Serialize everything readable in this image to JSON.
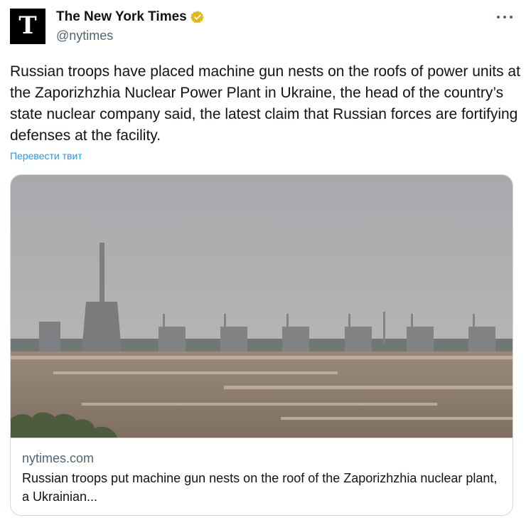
{
  "account": {
    "name": "The New York Times",
    "handle": "@nytimes",
    "avatar_glyph": "T",
    "verified_color": "#e2b719"
  },
  "tweet": {
    "text": "Russian troops have placed machine gun nests on the roofs of power units at the Zaporizhzhia Nuclear Power Plant in Ukraine, the head of the country’s state nuclear company said, the latest claim that Russian forces are fortifying defenses at the facility.",
    "translate_link": "Перевести твит"
  },
  "card": {
    "domain": "nytimes.com",
    "title": "Russian troops put machine gun nests on the roof of the Zaporizhzhia nuclear plant, a Ukrainian..."
  },
  "icons": {
    "more": "more-dots-icon",
    "verified": "verified-badge-icon"
  },
  "colors": {
    "link": "#1d9bf0",
    "secondary_text": "#536471",
    "border": "#cfd9de"
  }
}
